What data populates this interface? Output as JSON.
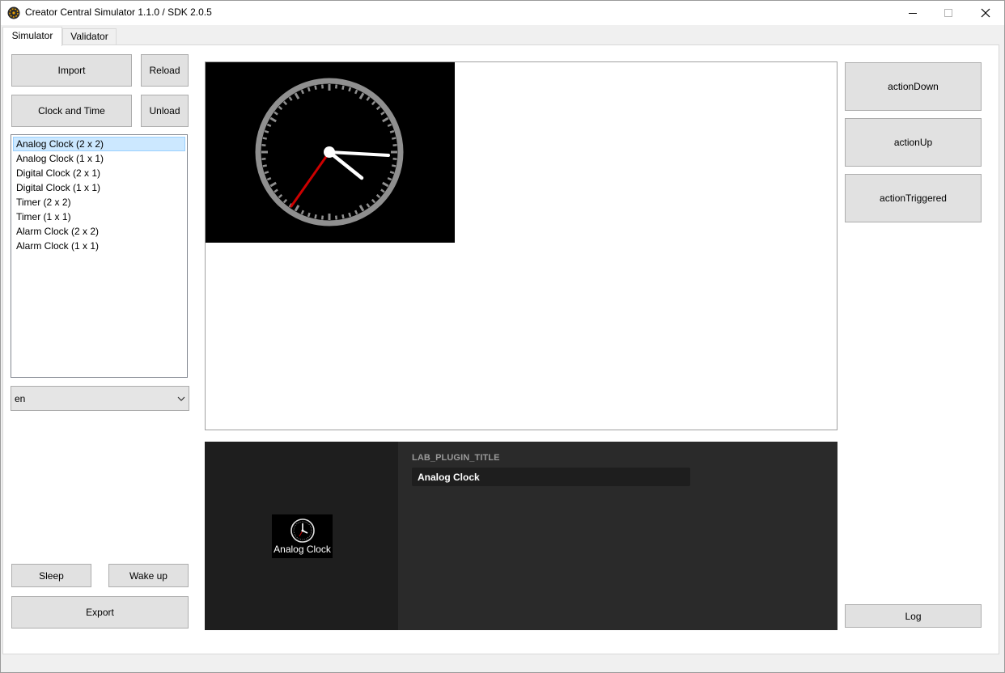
{
  "window": {
    "title": "Creator Central Simulator 1.1.0 / SDK 2.0.5",
    "icon": "app-icon"
  },
  "tabs": [
    {
      "label": "Simulator",
      "active": true
    },
    {
      "label": "Validator",
      "active": false
    }
  ],
  "left_panel": {
    "import_label": "Import",
    "reload_label": "Reload",
    "plugin_label": "Clock and Time",
    "unload_label": "Unload",
    "widgets": [
      {
        "label": "Analog Clock (2 x 2)",
        "selected": true
      },
      {
        "label": "Analog Clock (1 x 1)"
      },
      {
        "label": "Digital Clock (2 x 1)"
      },
      {
        "label": "Digital Clock (1 x 1)"
      },
      {
        "label": "Timer (2 x 2)"
      },
      {
        "label": "Timer (1 x 1)"
      },
      {
        "label": "Alarm Clock (2 x 2)"
      },
      {
        "label": "Alarm Clock (1 x 1)"
      }
    ],
    "language": "en",
    "sleep_label": "Sleep",
    "wake_label": "Wake up",
    "export_label": "Export"
  },
  "right_panel": {
    "action_down": "actionDown",
    "action_up": "actionUp",
    "action_triggered": "actionTriggered",
    "log_label": "Log"
  },
  "property_panel": {
    "tile_label": "Analog Clock",
    "field_label": "LAB_PLUGIN_TITLE",
    "field_value": "Analog Clock"
  },
  "colors": {
    "selection": "#cce8ff",
    "second_hand": "#cc0000",
    "dark_panel": "#2a2a2a"
  }
}
